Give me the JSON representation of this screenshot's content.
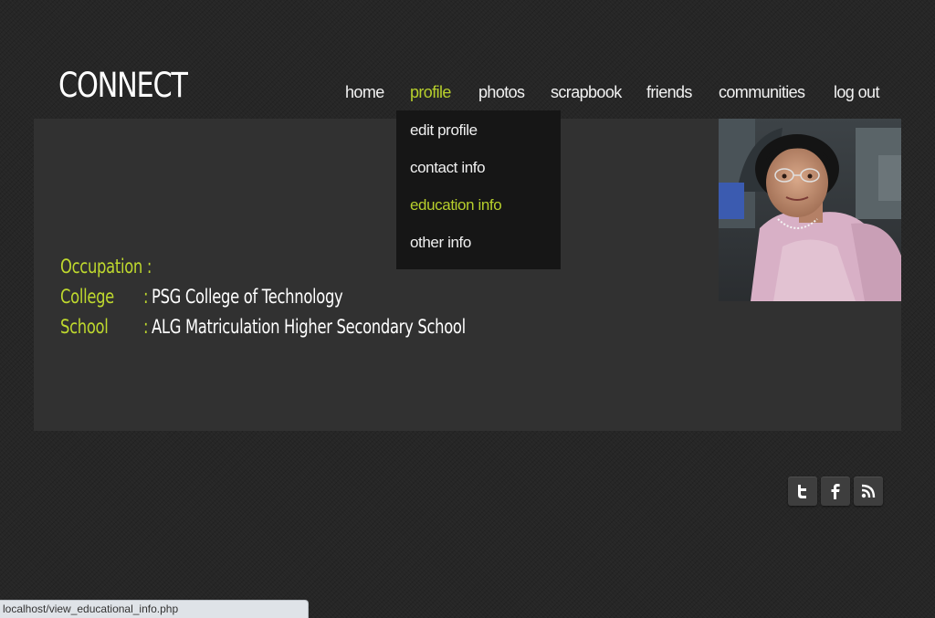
{
  "site": {
    "logo": "CONNECT",
    "accent_color": "#b7cf2c"
  },
  "nav": {
    "items": [
      {
        "label": "home",
        "active": false
      },
      {
        "label": "profile",
        "active": true
      },
      {
        "label": "photos",
        "active": false
      },
      {
        "label": "scrapbook",
        "active": false
      },
      {
        "label": "friends",
        "active": false
      },
      {
        "label": "communities",
        "active": false
      },
      {
        "label": "log out",
        "active": false
      }
    ]
  },
  "profile_menu": {
    "items": [
      {
        "label": "edit profile",
        "active": false
      },
      {
        "label": "contact info",
        "active": false
      },
      {
        "label": "education info",
        "active": true
      },
      {
        "label": "other info",
        "active": false
      }
    ]
  },
  "education": {
    "occupation_label": "Occupation :",
    "college_label": "College",
    "college_colon": ":",
    "college_value": "PSG College of Technology",
    "school_label": "School",
    "school_colon": ":",
    "school_value": "ALG Matriculation Higher Secondary School"
  },
  "social": {
    "icons": [
      "twitter-icon",
      "facebook-icon",
      "rss-icon"
    ]
  },
  "statusbar": {
    "url": "localhost/view_educational_info.php"
  }
}
